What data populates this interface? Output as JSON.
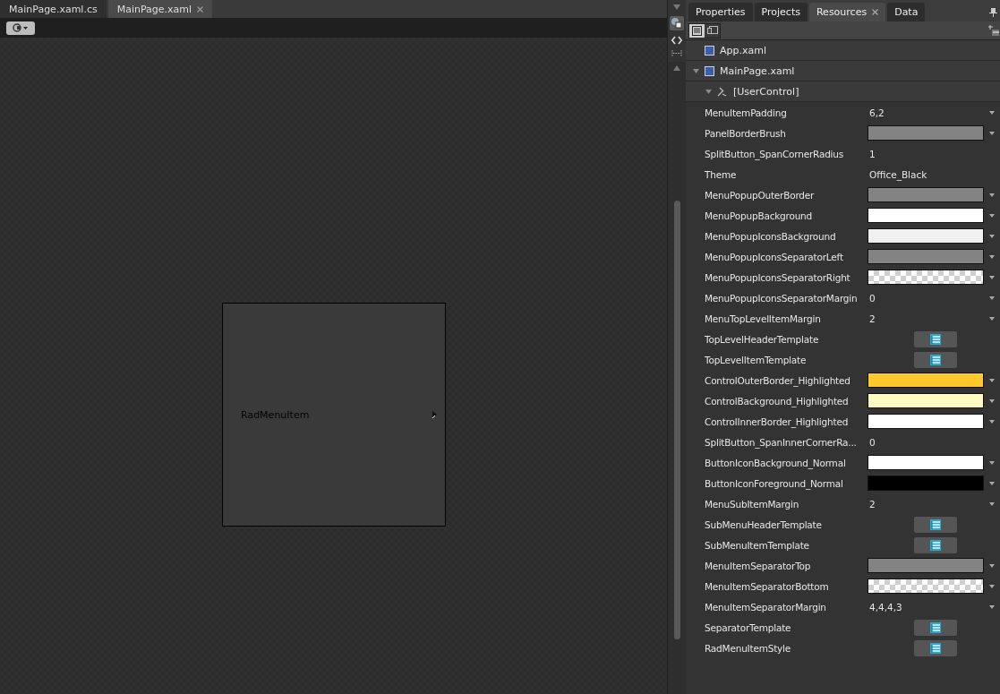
{
  "editor_tabs": [
    {
      "label": "MainPage.xaml.cs",
      "selected": false,
      "closable": false
    },
    {
      "label": "MainPage.xaml",
      "selected": true,
      "closable": true
    }
  ],
  "design_canvas": {
    "menu_item": {
      "label": "RadMenuItem"
    }
  },
  "panel_tabs": [
    {
      "label": "Properties",
      "selected": false,
      "closable": false
    },
    {
      "label": "Projects",
      "selected": false,
      "closable": false
    },
    {
      "label": "Resources",
      "selected": true,
      "closable": true
    },
    {
      "label": "Data",
      "selected": false,
      "closable": false
    }
  ],
  "panel_view_buttons": [
    {
      "selected": true
    },
    {
      "selected": false
    }
  ],
  "resource_tree": [
    {
      "label": "App.xaml",
      "kind": "file"
    },
    {
      "label": "MainPage.xaml",
      "kind": "file",
      "expanded": true,
      "children": [
        {
          "label": "[UserControl]",
          "kind": "control",
          "expanded": true
        }
      ]
    }
  ],
  "resources": [
    {
      "name": "MenuItemPadding",
      "kind": "text",
      "value": "6,2",
      "dropdown": true
    },
    {
      "name": "PanelBorderBrush",
      "kind": "brush",
      "color": "#838383",
      "dropdown": true
    },
    {
      "name": "SplitButton_SpanCornerRadius",
      "kind": "text",
      "value": "1",
      "dropdown": false
    },
    {
      "name": "Theme",
      "kind": "text",
      "value": "Office_Black",
      "dropdown": false
    },
    {
      "name": "MenuPopupOuterBorder",
      "kind": "brush",
      "color": "#838383",
      "dropdown": true
    },
    {
      "name": "MenuPopupBackground",
      "kind": "brush",
      "color": "#ffffff",
      "dropdown": true
    },
    {
      "name": "MenuPopupIconsBackground",
      "kind": "brush",
      "color": "#f0f0f0",
      "dropdown": true
    },
    {
      "name": "MenuPopupIconsSeparatorLeft",
      "kind": "brush",
      "color": "#838383",
      "dropdown": true
    },
    {
      "name": "MenuPopupIconsSeparatorRight",
      "kind": "transparent",
      "dropdown": true
    },
    {
      "name": "MenuPopupIconsSeparatorMargin",
      "kind": "text",
      "value": "0",
      "dropdown": true
    },
    {
      "name": "MenuTopLevelItemMargin",
      "kind": "text",
      "value": "2",
      "dropdown": true
    },
    {
      "name": "TopLevelHeaderTemplate",
      "kind": "template",
      "dropdown": false
    },
    {
      "name": "TopLevelItemTemplate",
      "kind": "template",
      "dropdown": false
    },
    {
      "name": "ControlOuterBorder_Highlighted",
      "kind": "brush",
      "color": "#ffc92b",
      "dropdown": true
    },
    {
      "name": "ControlBackground_Highlighted",
      "kind": "brush",
      "color": "#fffbc1",
      "dropdown": true
    },
    {
      "name": "ControlInnerBorder_Highlighted",
      "kind": "brush",
      "color": "#ffffff",
      "dropdown": true
    },
    {
      "name": "SplitButton_SpanInnerCornerRa...",
      "kind": "text",
      "value": "0",
      "dropdown": false
    },
    {
      "name": "ButtonIconBackground_Normal",
      "kind": "brush",
      "color": "#ffffff",
      "dropdown": true
    },
    {
      "name": "ButtonIconForeground_Normal",
      "kind": "brush",
      "color": "#000000",
      "dropdown": true
    },
    {
      "name": "MenuSubItemMargin",
      "kind": "text",
      "value": "2",
      "dropdown": true
    },
    {
      "name": "SubMenuHeaderTemplate",
      "kind": "template",
      "dropdown": false
    },
    {
      "name": "SubMenuItemTemplate",
      "kind": "template",
      "dropdown": false
    },
    {
      "name": "MenuItemSeparatorTop",
      "kind": "brush",
      "color": "#838383",
      "dropdown": true
    },
    {
      "name": "MenuItemSeparatorBottom",
      "kind": "transparent",
      "dropdown": true
    },
    {
      "name": "MenuItemSeparatorMargin",
      "kind": "text",
      "value": "4,4,4,3",
      "dropdown": true
    },
    {
      "name": "SeparatorTemplate",
      "kind": "template",
      "dropdown": false
    },
    {
      "name": "RadMenuItemStyle",
      "kind": "template",
      "dropdown": false
    }
  ]
}
